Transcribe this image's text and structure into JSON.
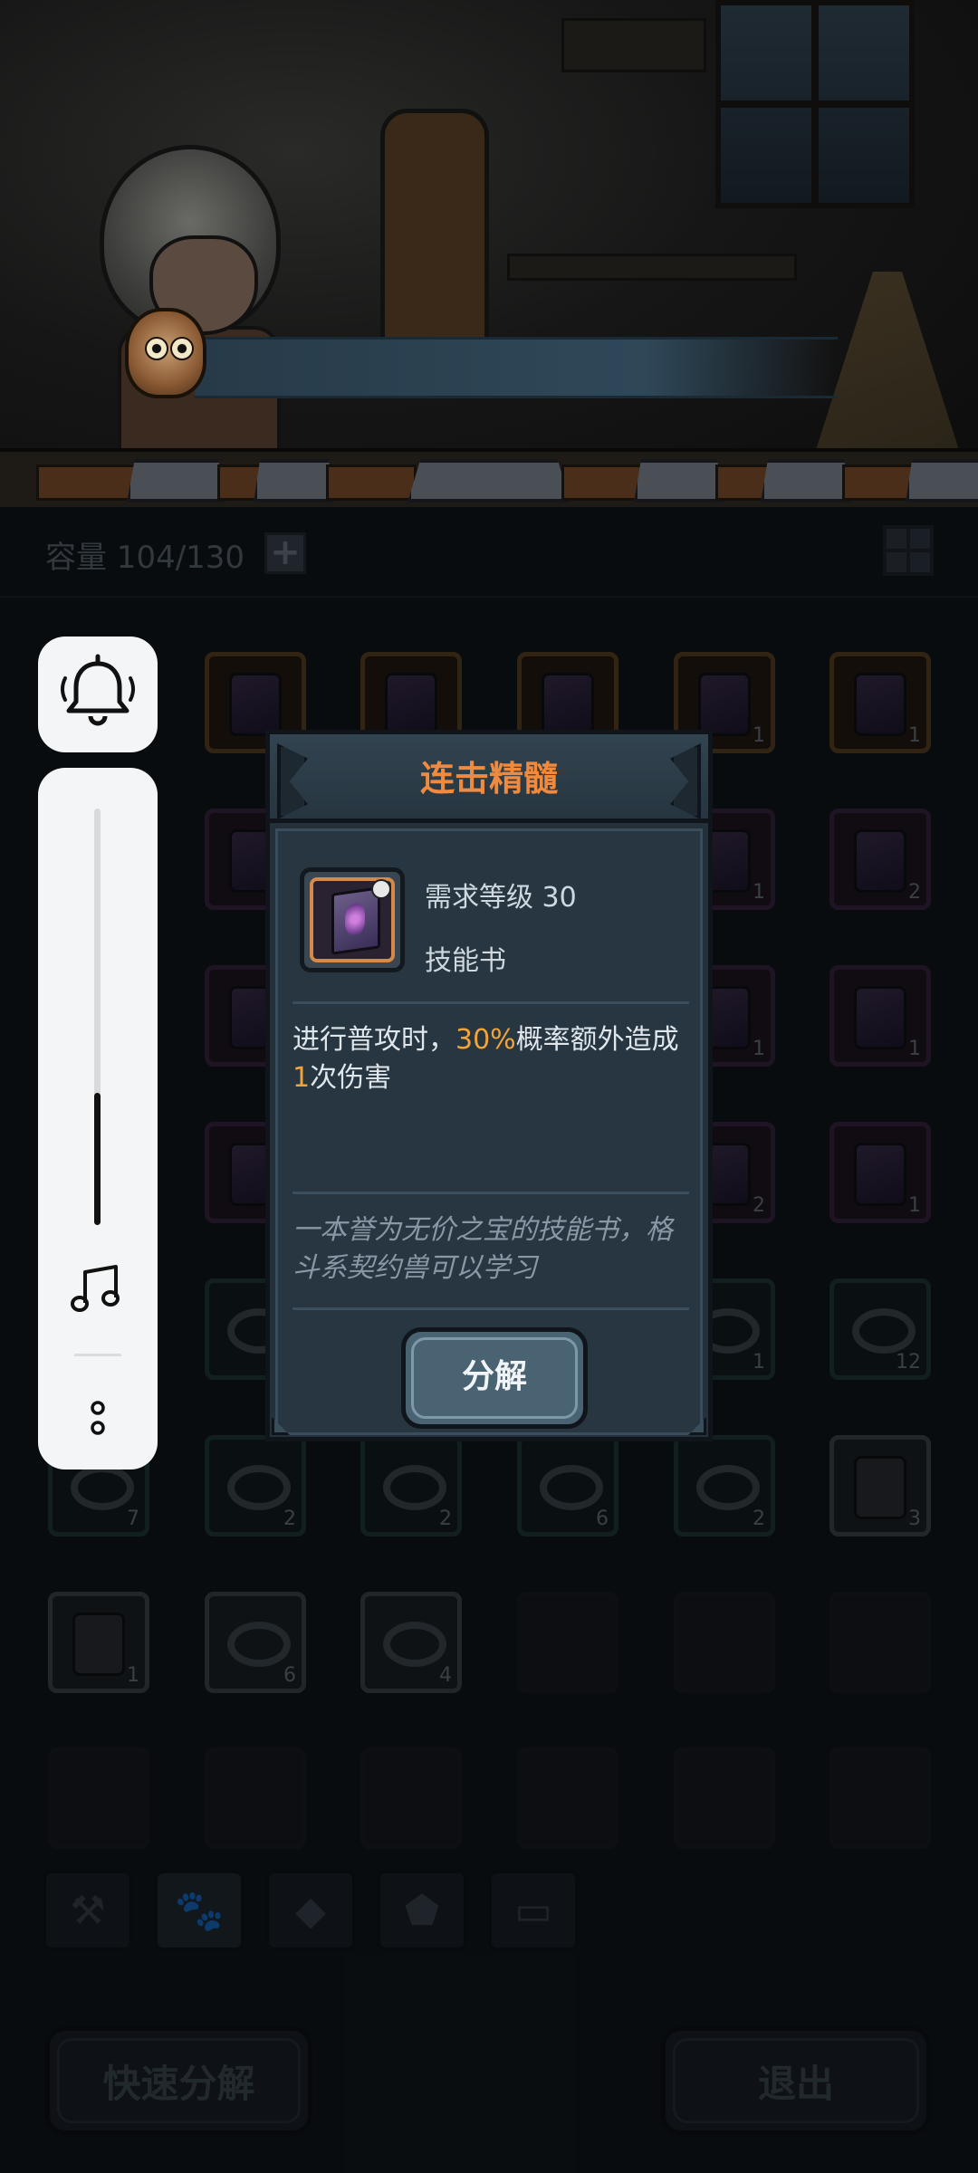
{
  "inventory": {
    "capacity_label": "容量 104/130",
    "add_symbol": "+",
    "slot_counts": {
      "r1c4": "1",
      "r1c5": "1",
      "r2c4": "1",
      "r2c5": "2",
      "r3c4": "1",
      "r3c5": "1",
      "r4c4": "2",
      "r4c5": "1",
      "r5c4": "1",
      "r5c5": "12",
      "r6c0": "7",
      "r6c1": "2",
      "r6c2": "2",
      "r6c3": "6",
      "r6c4": "2",
      "r6c5": "3",
      "r7c0": "1",
      "r7c1": "6",
      "r7c2": "4"
    }
  },
  "tabs": [
    {
      "name": "tab-equipment",
      "icon": "hammer-wrench-icon",
      "glyph": "⚒"
    },
    {
      "name": "tab-pets",
      "icon": "paw-icon",
      "glyph": "🐾"
    },
    {
      "name": "tab-gems",
      "icon": "gem-icon",
      "glyph": "◆"
    },
    {
      "name": "tab-materials",
      "icon": "ore-icon",
      "glyph": "⬟"
    },
    {
      "name": "tab-chests",
      "icon": "chest-icon",
      "glyph": "▭"
    }
  ],
  "buttons": {
    "quick_decompose": "快速分解",
    "exit": "退出"
  },
  "side_panel": {
    "top_icon": "bell-icon",
    "music_icon": "music-note-icon",
    "more_icon": "more-dots-icon",
    "volume_level": 0.3
  },
  "dialog": {
    "title": "连击精髓",
    "required_level": "需求等级 30",
    "item_type": "技能书",
    "effect_part1": "进行普攻时，",
    "effect_highlight1": "30%",
    "effect_part2": "概率额外造成",
    "effect_highlight2": "1",
    "effect_part3": "次伤害",
    "flavor": "一本誉为无价之宝的技能书，格斗系契约兽可以学习",
    "decompose_button": "分解"
  },
  "colors": {
    "title_orange": "#f08a3e",
    "highlight_gold": "#f0a43a",
    "dialog_bg": "#24313b",
    "button_bg": "#4a6372"
  }
}
